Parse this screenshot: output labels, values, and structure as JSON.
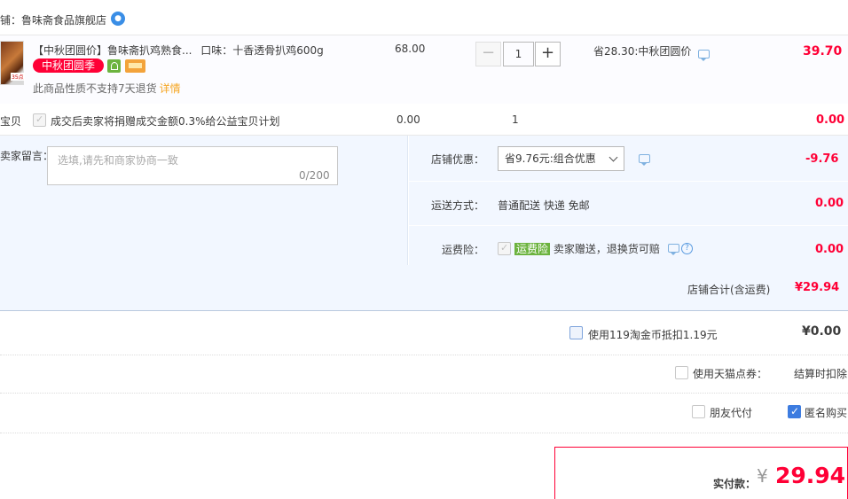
{
  "shop": {
    "label": "铺：鲁味斋食品旗舰店",
    "ww_icon": "wangwang-chat-icon"
  },
  "item": {
    "title": "【中秋团圆价】鲁味斋扒鸡熟食...",
    "flavor": "口味：十香透骨扒鸡600g",
    "thumb_tag": "35点",
    "promo_badge": "中秋团圆季",
    "no_return": "此商品性质不支持7天退货",
    "detail_link": "详情",
    "unit_price": "68.00",
    "qty_minus": "−",
    "qty": "1",
    "qty_plus": "+",
    "save_text": "省28.30:中秋团圆价",
    "total": "39.70"
  },
  "charity": {
    "label": "宝贝",
    "text": "成交后卖家将捐赠成交金额0.3%给公益宝贝计划",
    "price": "0.00",
    "qty": "1",
    "total": "0.00"
  },
  "message": {
    "label": "卖家留言：",
    "placeholder": "选填,请先和商家协商一致",
    "count": "0/200"
  },
  "discount": {
    "label": "店铺优惠：",
    "selected": "省9.76元:组合优惠",
    "amount": "-9.76"
  },
  "shipping": {
    "label": "运送方式：",
    "text": "普通配送 快递 免邮",
    "amount": "0.00"
  },
  "insurance": {
    "label": "运费险：",
    "tag": "运费险",
    "text": "卖家赠送，退换货可赔",
    "help": "?",
    "amount": "0.00"
  },
  "shop_total": {
    "label": "店铺合计(含运费)",
    "amount": "¥29.94"
  },
  "coins": {
    "label": "使用119淘金币抵扣1.19元",
    "amount": "¥0.00"
  },
  "points": {
    "label": "使用天猫点券：",
    "note": "结算时扣除"
  },
  "options": {
    "friend_pay": "朋友代付",
    "anonymous": "匿名购买"
  },
  "payment": {
    "label": "实付款：",
    "currency": "¥",
    "amount": "29.94"
  },
  "colors": {
    "accent_red": "#ff0036",
    "panel_blue": "#f2f7ff",
    "green": "#6cb33f",
    "check_blue": "#3d7ce0"
  }
}
